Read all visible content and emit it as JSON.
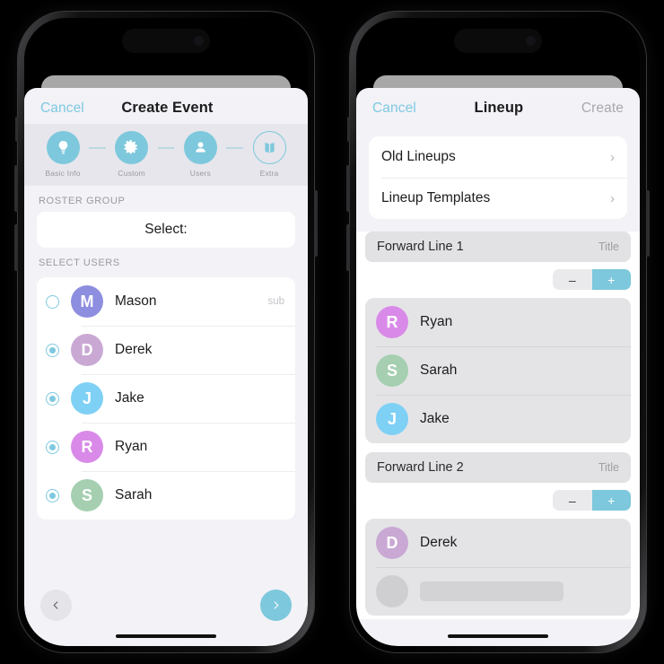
{
  "accent": "#7dc8dc",
  "link_color": "#7ec9e0",
  "background": "#000000",
  "sheet_bg": "#f2f2f7",
  "phones": {
    "left": {
      "nav": {
        "cancel_label": "Cancel",
        "title": "Create Event",
        "right_label": ""
      },
      "stepper": {
        "steps": [
          {
            "label": "Basic Info",
            "icon": "lightbulb-icon",
            "state": "filled"
          },
          {
            "label": "Custom",
            "icon": "gear-icon",
            "state": "filled"
          },
          {
            "label": "Users",
            "icon": "person-icon",
            "state": "filled"
          },
          {
            "label": "Extra",
            "icon": "book-icon",
            "state": "outline"
          }
        ]
      },
      "roster_group": {
        "section_label": "ROSTER GROUP",
        "select_value": "Select:"
      },
      "select_users": {
        "section_label": "SELECT USERS",
        "users": [
          {
            "initial": "M",
            "name": "Mason",
            "color": "#8e8ee0",
            "selected": false,
            "tag": "sub"
          },
          {
            "initial": "D",
            "name": "Derek",
            "color": "#c9a8d4",
            "selected": true,
            "tag": ""
          },
          {
            "initial": "J",
            "name": "Jake",
            "color": "#7fd0f5",
            "selected": true,
            "tag": ""
          },
          {
            "initial": "R",
            "name": "Ryan",
            "color": "#d98ae8",
            "selected": true,
            "tag": ""
          },
          {
            "initial": "S",
            "name": "Sarah",
            "color": "#a5cfb0",
            "selected": true,
            "tag": ""
          }
        ]
      },
      "bottom_nav": {
        "prev_icon": "chevron-left-icon",
        "next_icon": "chevron-right-icon"
      }
    },
    "right": {
      "nav": {
        "cancel_label": "Cancel",
        "title": "Lineup",
        "right_label": "Create"
      },
      "menu": {
        "items": [
          {
            "label": "Old Lineups",
            "chevron": "›"
          },
          {
            "label": "Lineup Templates",
            "chevron": "›"
          }
        ]
      },
      "lines": [
        {
          "title": "Forward Line 1",
          "title_tag": "Title",
          "stepper": {
            "minus": "–",
            "plus": "+"
          },
          "members": [
            {
              "initial": "R",
              "name": "Ryan",
              "color": "#d98ae8"
            },
            {
              "initial": "S",
              "name": "Sarah",
              "color": "#a5cfb0"
            },
            {
              "initial": "J",
              "name": "Jake",
              "color": "#7fd0f5"
            }
          ]
        },
        {
          "title": "Forward Line 2",
          "title_tag": "Title",
          "stepper": {
            "minus": "–",
            "plus": "+"
          },
          "members": [
            {
              "initial": "D",
              "name": "Derek",
              "color": "#c9a8d4"
            }
          ]
        }
      ]
    }
  }
}
